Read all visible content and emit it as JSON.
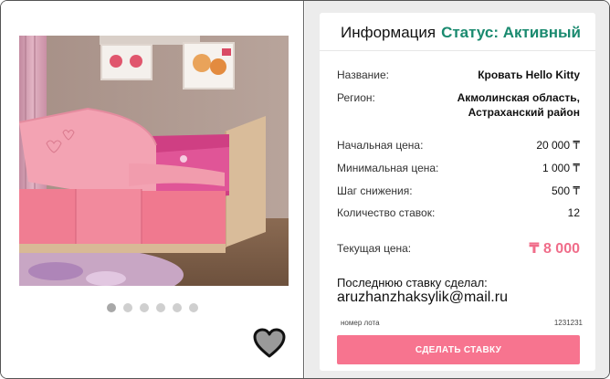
{
  "gallery": {
    "image_alt": "Кровать Hello Kitty",
    "dots_count": 6,
    "active_dot": 0
  },
  "info": {
    "title": "Информация",
    "status": "Статус: Активный",
    "status_color": "#1a8a6f"
  },
  "fields": {
    "name_label": "Название:",
    "name_value": "Кровать Hello Kitty",
    "region_label": "Регион:",
    "region_value_line1": "Акмолинская область,",
    "region_value_line2": "Астраханский район",
    "start_price_label": "Начальная цена:",
    "start_price_value": "20 000 ₸",
    "min_price_label": "Минимальная цена:",
    "min_price_value": "1 000 ₸",
    "step_label": "Шаг снижения:",
    "step_value": "500 ₸",
    "bids_count_label": "Количество ставок:",
    "bids_count_value": "12",
    "current_price_label": "Текущая цена:",
    "current_price_value": "₸ 8 000"
  },
  "last_bid": {
    "label": "Последнюю ставку сделал:",
    "email": "aruzhanzhaksylik@mail.ru"
  },
  "lot": {
    "label": "номер лота",
    "number": "1231231"
  },
  "actions": {
    "bid_button": "СДЕЛАТЬ СТАВКУ"
  },
  "colors": {
    "accent": "#f7748f",
    "current_price": "#f06d8a"
  },
  "icons": {
    "favorite": "heart-icon"
  }
}
